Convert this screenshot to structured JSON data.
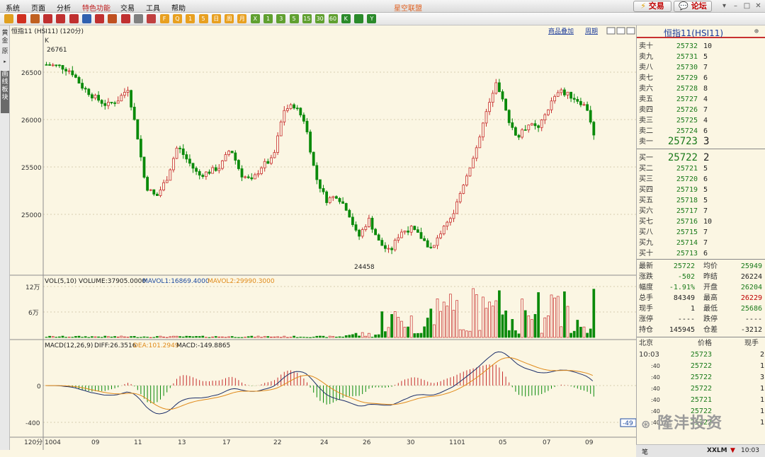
{
  "menubar": {
    "items": [
      {
        "label": "系统",
        "special": false
      },
      {
        "label": "页面",
        "special": false
      },
      {
        "label": "分析",
        "special": false
      },
      {
        "label": "特色功能",
        "special": true
      },
      {
        "label": "交易",
        "special": false
      },
      {
        "label": "工具",
        "special": false
      },
      {
        "label": "帮助",
        "special": false
      }
    ],
    "brand": "星空联盟",
    "trade_button": "交易",
    "forum_button": "论坛"
  },
  "toolbar": {
    "icons": [
      "back-icon",
      "home-icon",
      "news-icon",
      "search-icon",
      "zoom-in-icon",
      "zoom-out-icon",
      "draw-icon",
      "pen-icon",
      "brush-icon",
      "cup-icon",
      "list-icon",
      "chart-icon",
      "f10-icon",
      "quote-icon",
      "one-min-icon",
      "five-min-icon",
      "day-icon",
      "week-icon",
      "month-icon",
      "x-icon",
      "n1-icon",
      "n3-icon",
      "n5-icon",
      "n15-icon",
      "n30-icon",
      "n60-icon",
      "kline-icon",
      "ticks-icon",
      "y-icon"
    ],
    "labels": [
      "",
      "",
      "",
      "",
      "",
      "",
      "",
      "",
      "",
      "",
      "",
      "",
      "F",
      "Q",
      "1",
      "5",
      "日",
      "周",
      "月",
      "X",
      "1",
      "3",
      "5",
      "15",
      "30",
      "60",
      "K",
      "",
      "Y"
    ]
  },
  "lefttabs": [
    "黄金",
    "原",
    "画线板块"
  ],
  "chart": {
    "title": "恒指11 (HSI11) (120分)",
    "top_links": [
      "商品叠加",
      "周期"
    ],
    "k_label": "K",
    "price_axis": [
      "26500",
      "26000",
      "25500",
      "25000"
    ],
    "hi_label": "26761",
    "lo_label": "24458",
    "volume_header": {
      "main": "VOL(5,10) VOLUME:37905.0000",
      "mavol1": "MAVOL1:16869.4000",
      "mavol2": "MAVOL2:29990.3000"
    },
    "volume_axis": [
      "12万",
      "6万"
    ],
    "macd_header": {
      "main": "MACD(12,26,9)",
      "diff": "DIFF:26.3516",
      "dea": "DEA:101.2949",
      "macd": "MACD:-149.8865"
    },
    "macd_axis": [
      "0",
      "-400"
    ],
    "macd_right_tag": "-49",
    "date_axis": {
      "period": "120分",
      "labels": [
        "1004",
        "09",
        "11",
        "13",
        "17",
        "22",
        "24",
        "26",
        "30",
        "1101",
        "05",
        "07",
        "09"
      ]
    }
  },
  "quote": {
    "title": "恒指11(HSI11)",
    "asks": [
      {
        "label": "卖十",
        "price": "25732",
        "vol": "10"
      },
      {
        "label": "卖九",
        "price": "25731",
        "vol": "5"
      },
      {
        "label": "卖八",
        "price": "25730",
        "vol": "7"
      },
      {
        "label": "卖七",
        "price": "25729",
        "vol": "6"
      },
      {
        "label": "卖六",
        "price": "25728",
        "vol": "8"
      },
      {
        "label": "卖五",
        "price": "25727",
        "vol": "4"
      },
      {
        "label": "卖四",
        "price": "25726",
        "vol": "7"
      },
      {
        "label": "卖三",
        "price": "25725",
        "vol": "4"
      },
      {
        "label": "卖二",
        "price": "25724",
        "vol": "6"
      },
      {
        "label": "卖一",
        "price": "25723",
        "vol": "3"
      }
    ],
    "bids": [
      {
        "label": "买一",
        "price": "25722",
        "vol": "2"
      },
      {
        "label": "买二",
        "price": "25721",
        "vol": "5"
      },
      {
        "label": "买三",
        "price": "25720",
        "vol": "6"
      },
      {
        "label": "买四",
        "price": "25719",
        "vol": "5"
      },
      {
        "label": "买五",
        "price": "25718",
        "vol": "5"
      },
      {
        "label": "买六",
        "price": "25717",
        "vol": "7"
      },
      {
        "label": "买七",
        "price": "25716",
        "vol": "10"
      },
      {
        "label": "买八",
        "price": "25715",
        "vol": "7"
      },
      {
        "label": "买九",
        "price": "25714",
        "vol": "7"
      },
      {
        "label": "买十",
        "price": "25713",
        "vol": "6"
      }
    ],
    "stats": [
      {
        "l1": "最新",
        "v1": "25722",
        "c1": "#1a7a1a",
        "l2": "均价",
        "v2": "25949",
        "c2": "#1a7a1a"
      },
      {
        "l1": "涨跌",
        "v1": "-502",
        "c1": "#1a7a1a",
        "l2": "昨结",
        "v2": "26224",
        "c2": "#222"
      },
      {
        "l1": "幅度",
        "v1": "-1.91%",
        "c1": "#1a7a1a",
        "l2": "开盘",
        "v2": "26204",
        "c2": "#1a7a1a"
      },
      {
        "l1": "总手",
        "v1": "84349",
        "c1": "#222",
        "l2": "最高",
        "v2": "26229",
        "c2": "#c00000"
      },
      {
        "l1": "现手",
        "v1": "1",
        "c1": "#222",
        "l2": "最低",
        "v2": "25686",
        "c2": "#1a7a1a"
      },
      {
        "l1": "涨停",
        "v1": "----",
        "c1": "#222",
        "l2": "跌停",
        "v2": "----",
        "c2": "#222"
      },
      {
        "l1": "持仓",
        "v1": "145945",
        "c1": "#222",
        "l2": "仓差",
        "v2": "-3212",
        "c2": "#222"
      }
    ],
    "ticks_header": {
      "time": "北京",
      "price": "价格",
      "vol": "现手"
    },
    "ticks": [
      {
        "time": "10:03",
        "price": "25723",
        "vol": "2"
      },
      {
        "time": ":40",
        "price": "25722",
        "vol": "1"
      },
      {
        "time": ":40",
        "price": "25722",
        "vol": "3"
      },
      {
        "time": ":40",
        "price": "25722",
        "vol": "1"
      },
      {
        "time": ":40",
        "price": "25721",
        "vol": "1"
      },
      {
        "time": ":40",
        "price": "25722",
        "vol": "1"
      },
      {
        "time": ":40",
        "price": "25722",
        "vol": "1"
      }
    ]
  },
  "statusbar": {
    "left": "笔",
    "brand": "XXLM",
    "time": "10:03"
  },
  "watermark": "隆沣投资",
  "colors": {
    "up": "#c83030",
    "down": "#0a8a0a",
    "bg": "#fbf6e3",
    "grid": "#d7cfb0",
    "mavol1": "#1d4aa0",
    "mavol2": "#e08a1a"
  }
}
